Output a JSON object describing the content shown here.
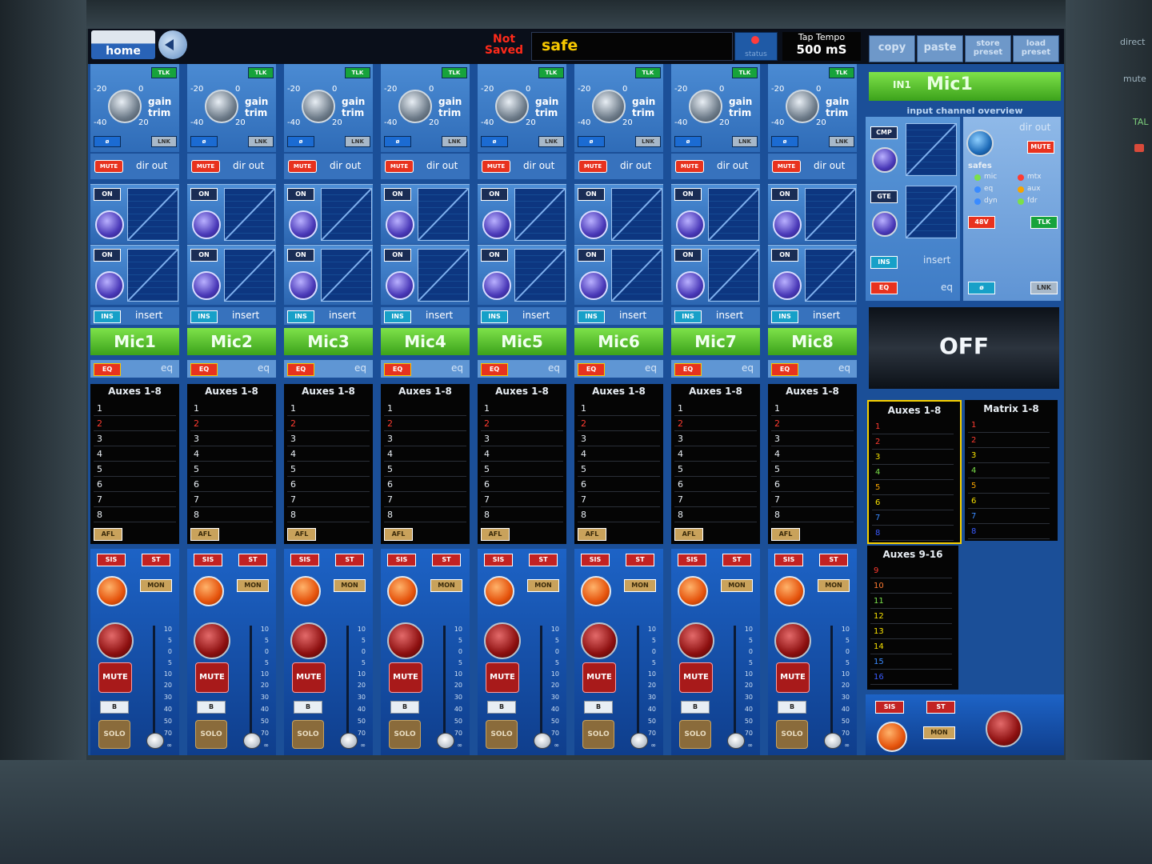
{
  "topbar": {
    "home_label": "home",
    "not_saved": "Not Saved",
    "scene_name": "safe",
    "status_label": "status",
    "tap_tempo_label": "Tap Tempo",
    "tap_tempo_value": "500 mS",
    "copy_label": "copy",
    "paste_label": "paste",
    "store_preset_label": "store preset",
    "load_preset_label": "load preset"
  },
  "strip_labels": {
    "tlk": "TLK",
    "phase": "ø",
    "lnk": "LNK",
    "gain": "gain",
    "trim": "trim",
    "scale_m20": "-20",
    "scale_0": "0",
    "scale_m40": "-40",
    "scale_20": "20",
    "mute_small": "MUTE",
    "dir_out": "dir out",
    "on": "ON",
    "ins": "INS",
    "insert": "insert",
    "eq_btn": "EQ",
    "eq": "eq",
    "auxes_title": "Auxes 1-8",
    "afl": "AFL",
    "sis": "SIS",
    "st": "ST",
    "mon": "MON",
    "mute": "MUTE",
    "b": "B",
    "solo": "SOLO",
    "fader_ticks": [
      "10",
      "5",
      "0",
      "5",
      "10",
      "20",
      "30",
      "40",
      "50",
      "70",
      "∞"
    ]
  },
  "channels": [
    {
      "name": "Mic1",
      "fader_level": 0.0
    },
    {
      "name": "Mic2",
      "fader_level": 0.0
    },
    {
      "name": "Mic3",
      "fader_level": 0.0
    },
    {
      "name": "Mic4",
      "fader_level": 0.0
    },
    {
      "name": "Mic5",
      "fader_level": 0.0
    },
    {
      "name": "Mic6",
      "fader_level": 0.0
    },
    {
      "name": "Mic7",
      "fader_level": 0.0
    },
    {
      "name": "Mic8",
      "fader_level": 0.0
    }
  ],
  "aux_numbers": [
    "1",
    "2",
    "3",
    "4",
    "5",
    "6",
    "7",
    "8"
  ],
  "overview": {
    "channel_tag": "IN1",
    "channel_name": "Mic1",
    "title": "input channel overview",
    "cmp": "CMP",
    "gte": "GTE",
    "ins": "INS",
    "insert": "insert",
    "eq_btn": "EQ",
    "eq": "eq",
    "dir_out": "dir out",
    "mute": "MUTE",
    "safes_title": "safes",
    "safes": [
      "mic",
      "eq",
      "dyn",
      "mtx",
      "aux",
      "fdr"
    ],
    "v48": "48V",
    "tlk": "TLK",
    "phase": "ø",
    "lnk": "LNK",
    "off_label": "OFF",
    "auxes_1_8_title": "Auxes 1-8",
    "matrix_title": "Matrix 1-8",
    "auxes_9_16_title": "Auxes 9-16",
    "auxes_9_16": [
      "9",
      "10",
      "11",
      "12",
      "13",
      "14",
      "15",
      "16"
    ],
    "sis": "SIS",
    "st": "ST",
    "mon": "MON"
  },
  "bus_colors": [
    "#ff3b30",
    "#ff3b30",
    "#f7e000",
    "#7be04a",
    "#f7a400",
    "#f7e000",
    "#3a8bff",
    "#3a5bff"
  ],
  "aux_9_16_colors": [
    "#ff3b30",
    "#ff7a30",
    "#7be04a",
    "#f7e000",
    "#f7e000",
    "#f7e000",
    "#3a8bff",
    "#3a5bff"
  ],
  "aux_strip_color_2": "#ff3b30",
  "bezel": {
    "direct": "direct",
    "mute": "mute",
    "tal": "TAL"
  }
}
